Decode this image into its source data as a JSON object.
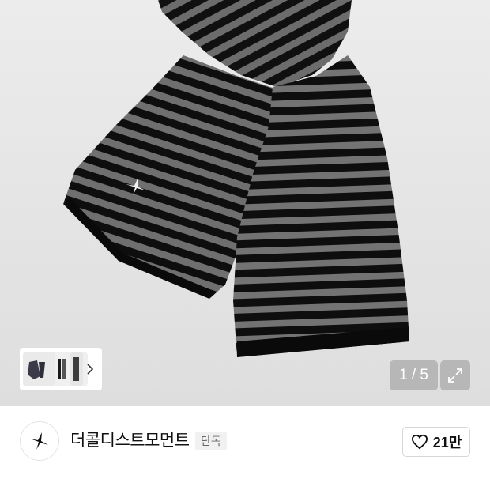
{
  "product_image": {
    "subject": "striped-knit-scarf",
    "stripe_colors": [
      "#0d0d0d",
      "#6e6e6e"
    ],
    "counter_text": "1 / 5"
  },
  "thumbnails": {
    "next_icon": "chevron-right-icon"
  },
  "shop": {
    "name": "더콜디스트모먼트",
    "badge": "단독",
    "logo_icon": "star-burst-icon",
    "like_label": "21만",
    "like_icon": "heart-icon"
  },
  "colors": {
    "overlay": "#969696",
    "text": "#111111",
    "border": "#d6d6d6"
  }
}
